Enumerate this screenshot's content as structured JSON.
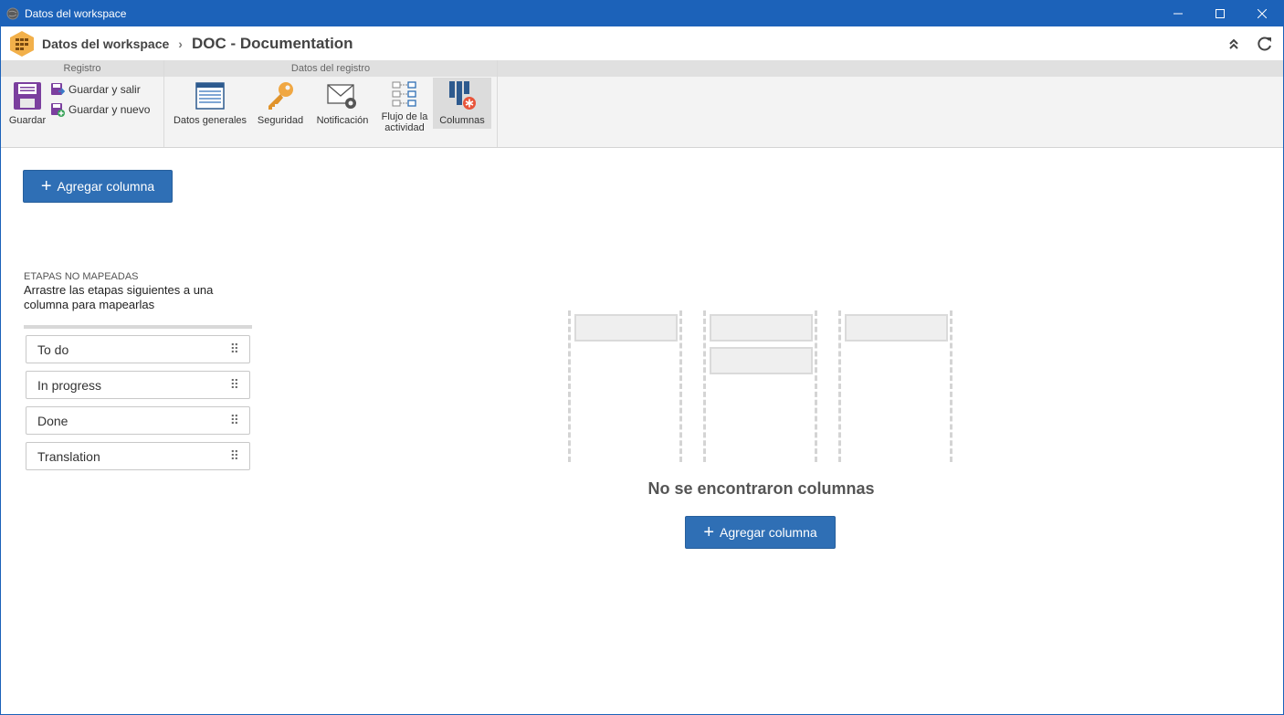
{
  "window": {
    "title": "Datos del workspace"
  },
  "breadcrumb": {
    "parent": "Datos del workspace",
    "separator": "›",
    "current": "DOC - Documentation"
  },
  "ribbon": {
    "group_registro": {
      "title": "Registro",
      "save": "Guardar",
      "save_exit": "Guardar y salir",
      "save_new": "Guardar y nuevo"
    },
    "group_datos": {
      "title": "Datos del registro",
      "items": [
        {
          "label": "Datos generales"
        },
        {
          "label": "Seguridad"
        },
        {
          "label": "Notificación"
        },
        {
          "label": "Flujo de la actividad"
        },
        {
          "label": "Columnas"
        }
      ]
    }
  },
  "main": {
    "add_column_label": "Agregar columna",
    "unmapped_title": "ETAPAS NO MAPEADAS",
    "unmapped_desc": "Arrastre las etapas siguientes a una columna para mapearlas",
    "stages": [
      {
        "label": "To do"
      },
      {
        "label": "In progress"
      },
      {
        "label": "Done"
      },
      {
        "label": "Translation"
      }
    ],
    "empty_title": "No se encontraron columnas",
    "empty_add_label": "Agregar columna"
  },
  "colors": {
    "titlebar": "#1c62b9",
    "primary": "#2f6fb5"
  }
}
